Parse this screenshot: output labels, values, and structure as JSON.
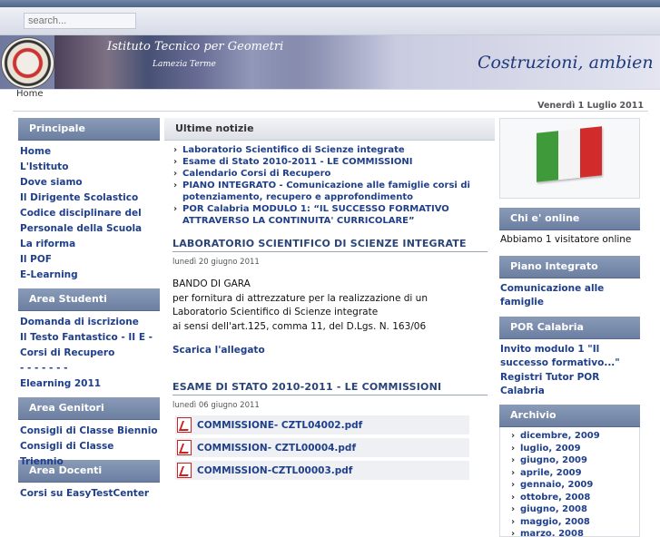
{
  "search": {
    "placeholder": "search..."
  },
  "banner": {
    "institute": "Istituto Tecnico per Geometri",
    "city": "Lamezia Terme",
    "slogan": "Costruzioni, ambien"
  },
  "breadcrumb": "Home",
  "date": "Venerdì 1 Luglio 2011",
  "left": {
    "principale": {
      "title": "Principale",
      "items": [
        "Home",
        "L'Istituto",
        "Dove siamo",
        "Il Dirigente Scolastico",
        "Codice disciplinare del Personale della Scuola",
        "La riforma",
        "Il POF",
        "E-Learning"
      ]
    },
    "studenti": {
      "title": "Area Studenti",
      "items": [
        "Domanda di iscrizione",
        "Il Testo Fantastico - II E - Corsi di Recupero",
        "- - - - - - -",
        "Elearning 2011"
      ]
    },
    "genitori": {
      "title": "Area Genitori",
      "items": [
        "Consigli di Classe Biennio",
        "Consigli di Classe Triennio"
      ]
    },
    "docenti": {
      "title": "Area Docenti",
      "items": [
        "Corsi su EasyTestCenter"
      ]
    }
  },
  "main": {
    "news_title": "Ultime notizie",
    "news": [
      "Laboratorio Scientifico di Scienze integrate",
      "Esame di Stato 2010-2011 - LE COMMISSIONI",
      "Calendario Corsi di Recupero",
      "PIANO INTEGRATO - Comunicazione alle famiglie corsi di potenziamento, recupero e approfondimento",
      "POR Calabria MODULO 1: “IL SUCCESSO FORMATIVO ATTRAVERSO LA CONTINUITA' CURRICOLARE”"
    ],
    "article1": {
      "title": "LABORATORIO SCIENTIFICO DI SCIENZE INTEGRATE",
      "date": "lunedì 20 giugno 2011",
      "lines": [
        "BANDO DI GARA",
        "per fornitura di  attrezzature per la realizzazione di un",
        "Laboratorio Scientifico di Scienze integrate",
        "ai sensi dell'art.125, comma 11, del D.Lgs. N. 163/06"
      ],
      "link": "Scarica l'allegato"
    },
    "article2": {
      "title": "ESAME DI STATO 2010-2011 - LE COMMISSIONI",
      "date": "lunedì 06 giugno 2011",
      "files": [
        "COMMISSIONE- CZTL04002.pdf",
        "COMMISSION- CZTL00004.pdf",
        "COMMISSION-CZTL00003.pdf"
      ]
    }
  },
  "right": {
    "flag_colors": [
      "#3f9a3a",
      "#f4f4f4",
      "#d22b2b"
    ],
    "online": {
      "title": "Chi e' online",
      "text": "Abbiamo 1 visitatore online"
    },
    "piano": {
      "title": "Piano Integrato",
      "link": "Comunicazione alle famiglie"
    },
    "por": {
      "title": "POR Calabria",
      "links": [
        "Invito modulo 1 \"Il successo formativo...\"",
        "Registri Tutor POR Calabria"
      ]
    },
    "archivio": {
      "title": "Archivio",
      "items": [
        "dicembre, 2009",
        "luglio, 2009",
        "giugno, 2009",
        "aprile, 2009",
        "gennaio, 2009",
        "ottobre, 2008",
        "giugno, 2008",
        "maggio, 2008",
        "marzo, 2008"
      ]
    }
  }
}
